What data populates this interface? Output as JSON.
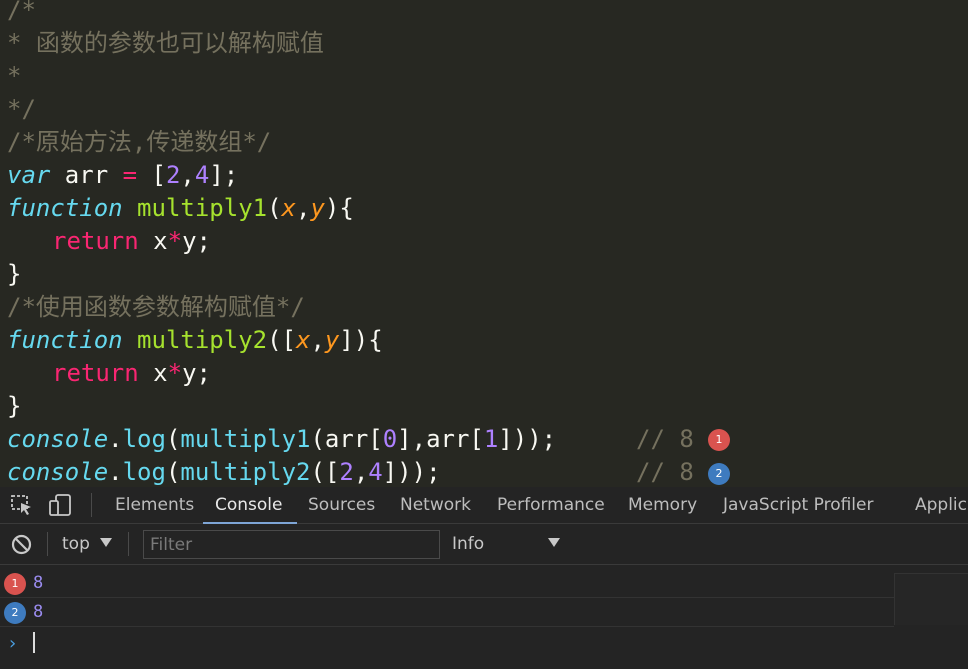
{
  "editor": {
    "lines": {
      "l1": "/*",
      "l2": "* 函数的参数也可以解构赋值",
      "l3": "*",
      "l4": "*/",
      "l5": "/*原始方法,传递数组*/",
      "l6": {
        "kw": "var",
        "name": " arr ",
        "eq": "=",
        "open": " [",
        "n1": "2",
        "comma": ",",
        "n2": "4",
        "close": "];"
      },
      "l7": {
        "kw": "function",
        "fn": " multiply1",
        "open": "(",
        "p1": "x",
        "comma": ",",
        "p2": "y",
        "close": "){"
      },
      "l8": {
        "ret": "return",
        "a": " x",
        "op": "*",
        "b": "y;"
      },
      "l9": "}",
      "l10": "/*使用函数参数解构赋值*/",
      "l11": {
        "kw": "function",
        "fn": " multiply2",
        "open": "([",
        "p1": "x",
        "comma": ",",
        "p2": "y",
        "close": "]){"
      },
      "l12": {
        "ret": "return",
        "a": " x",
        "op": "*",
        "b": "y;"
      },
      "l13": "}",
      "l14": {
        "obj": "console",
        "dot": ".",
        "method": "log",
        "open": "(",
        "call": "multiply1",
        "rest1": "(arr[",
        "n1": "0",
        "mid": "],arr[",
        "n2": "1",
        "end": "]));"
      },
      "l15": {
        "obj": "console",
        "dot": ".",
        "method": "log",
        "open": "(",
        "call": "multiply2",
        "rest1": "([",
        "n1": "2",
        "mid": ",",
        "n2": "4",
        "end": "]));"
      }
    },
    "results": [
      {
        "comment": "// 8",
        "badge": "1",
        "color": "#D9534F"
      },
      {
        "comment": "// 8",
        "badge": "2",
        "color": "#3E7BBF"
      }
    ]
  },
  "devtools": {
    "tabs": [
      "Elements",
      "Console",
      "Sources",
      "Network",
      "Performance",
      "Memory",
      "JavaScript Profiler",
      "Applica"
    ],
    "active_tab": "Console",
    "icons": [
      "inspect-element-icon",
      "device-toolbar-icon"
    ]
  },
  "console_toolbar": {
    "context": "top",
    "filter_placeholder": "Filter",
    "level": "Info",
    "icons": [
      "clear-console-icon",
      "dropdown-arrow-icon"
    ]
  },
  "console_output": {
    "rows": [
      {
        "badge": "1",
        "value": "8",
        "color": "#D9534F"
      },
      {
        "badge": "2",
        "value": "8",
        "color": "#3E7BBF"
      }
    ],
    "prompt_icon": "prompt-chevron-icon"
  }
}
